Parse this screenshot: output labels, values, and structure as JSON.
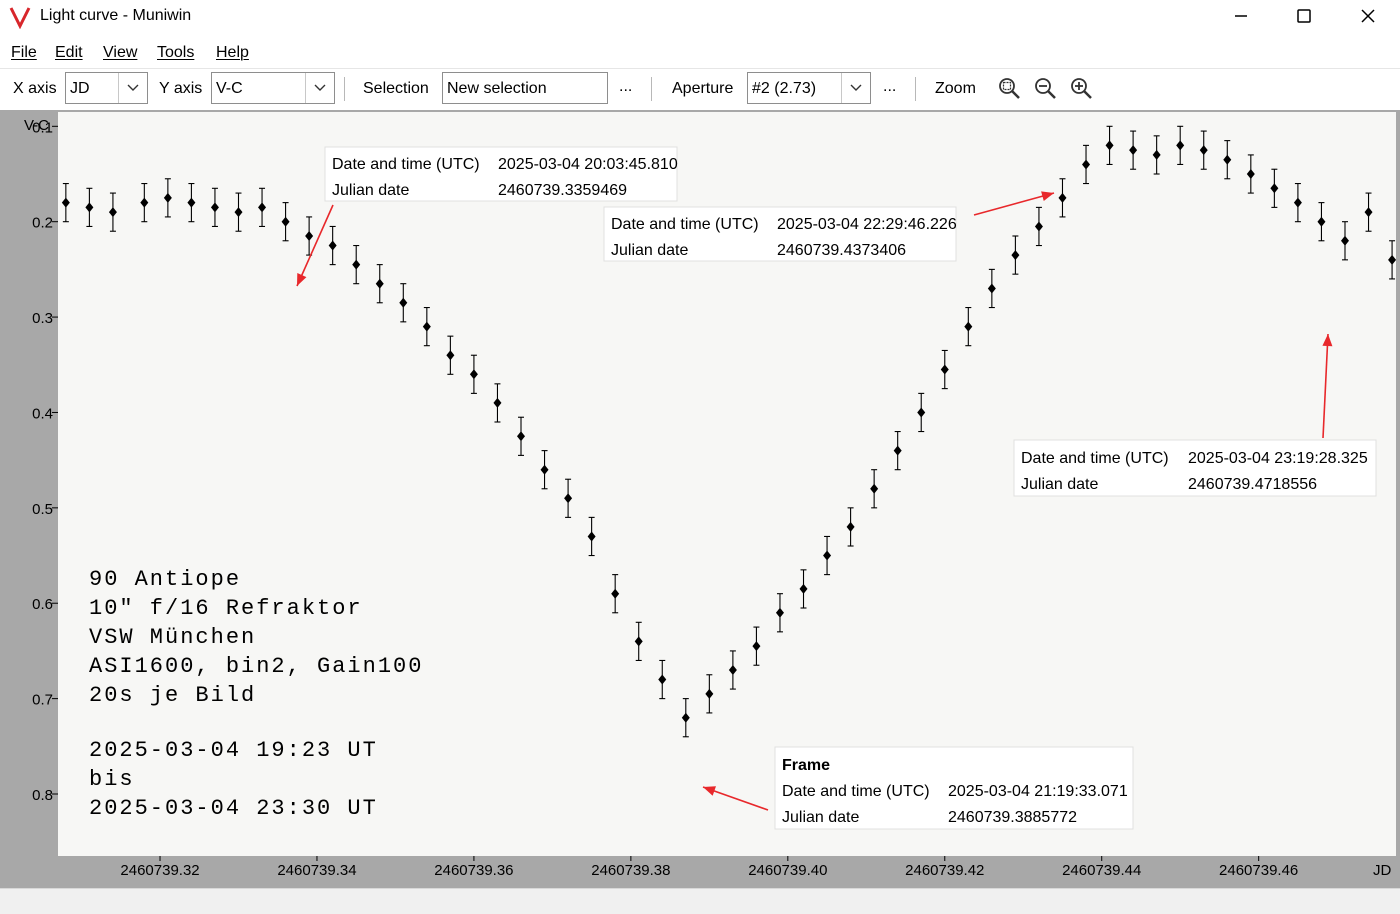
{
  "window": {
    "title": "Light curve - Muniwin"
  },
  "menu": [
    "File",
    "Edit",
    "View",
    "Tools",
    "Help"
  ],
  "toolbar": {
    "x_axis_label": "X axis",
    "x_axis_value": "JD",
    "y_axis_label": "Y axis",
    "y_axis_value": "V-C",
    "selection_label": "Selection",
    "selection_value": "New selection",
    "aperture_label": "Aperture",
    "aperture_value": "#2 (2.73)",
    "ellipsis": "...",
    "zoom_label": "Zoom"
  },
  "colors": {
    "plot_bg": "#f7f7f5",
    "frame_bg": "#a8a8a8",
    "marker": "#000000",
    "annotation_arrow": "#e8282b",
    "app_icon": "#d8262b"
  },
  "notes": {
    "lines_a": [
      "90 Antiope",
      "10\" f/16 Refraktor",
      "VSW München",
      "ASI1600, bin2, Gain100",
      "20s je Bild"
    ],
    "lines_b": [
      "2025-03-04 19:23 UT",
      "bis",
      "2025-03-04 23:30 UT"
    ]
  },
  "annotations": [
    {
      "header": "",
      "rows": [
        [
          "Date and time (UTC)",
          "2025-03-04 20:03:45.810"
        ],
        [
          "Julian date",
          "2460739.3359469"
        ]
      ]
    },
    {
      "header": "",
      "rows": [
        [
          "Date and time (UTC)",
          "2025-03-04 22:29:46.226"
        ],
        [
          "Julian date",
          "2460739.4373406"
        ]
      ]
    },
    {
      "header": "",
      "rows": [
        [
          "Date and time (UTC)",
          "2025-03-04 23:19:28.325"
        ],
        [
          "Julian date",
          "2460739.4718556"
        ]
      ]
    },
    {
      "header": "Frame",
      "rows": [
        [
          "Date and time (UTC)",
          "2025-03-04 21:19:33.071"
        ],
        [
          "Julian date",
          "2460739.3885772"
        ]
      ]
    }
  ],
  "chart_data": {
    "type": "scatter",
    "title": "",
    "xlabel": "JD",
    "ylabel": "V-C",
    "xlim": [
      2460739.307,
      2460739.4775
    ],
    "ylim": [
      0.085,
      0.865
    ],
    "y_inverted": true,
    "error_bars": true,
    "x_ticks": [
      2460739.32,
      2460739.34,
      2460739.36,
      2460739.38,
      2460739.4,
      2460739.42,
      2460739.44,
      2460739.46
    ],
    "x_tick_labels": [
      "2460739.32",
      "2460739.34",
      "2460739.36",
      "2460739.38",
      "2460739.40",
      "2460739.42",
      "2460739.44",
      "2460739.46"
    ],
    "y_ticks": [
      0.1,
      0.2,
      0.3,
      0.4,
      0.5,
      0.6,
      0.7,
      0.8
    ],
    "y_tick_labels": [
      "0.1",
      "0.2",
      "0.3",
      "0.4",
      "0.5",
      "0.6",
      "0.7",
      "0.8"
    ],
    "series": [
      {
        "x": [
          2460739.308,
          2460739.311,
          2460739.314,
          2460739.318,
          2460739.321,
          2460739.324,
          2460739.327,
          2460739.33,
          2460739.333,
          2460739.336,
          2460739.339,
          2460739.342,
          2460739.345,
          2460739.348,
          2460739.351,
          2460739.354,
          2460739.357,
          2460739.36,
          2460739.363,
          2460739.366,
          2460739.369,
          2460739.372,
          2460739.375,
          2460739.378,
          2460739.381,
          2460739.384,
          2460739.387,
          2460739.39,
          2460739.393,
          2460739.396,
          2460739.399,
          2460739.402,
          2460739.405,
          2460739.408,
          2460739.411,
          2460739.414,
          2460739.417,
          2460739.42,
          2460739.423,
          2460739.426,
          2460739.429,
          2460739.432,
          2460739.435,
          2460739.438,
          2460739.441,
          2460739.444,
          2460739.447,
          2460739.45,
          2460739.453,
          2460739.456,
          2460739.459,
          2460739.462,
          2460739.465,
          2460739.468,
          2460739.471,
          2460739.474,
          2460739.477
        ],
        "y": [
          0.18,
          0.185,
          0.19,
          0.18,
          0.175,
          0.18,
          0.185,
          0.19,
          0.185,
          0.2,
          0.215,
          0.225,
          0.245,
          0.265,
          0.285,
          0.31,
          0.34,
          0.36,
          0.39,
          0.425,
          0.46,
          0.49,
          0.53,
          0.59,
          0.64,
          0.68,
          0.72,
          0.695,
          0.67,
          0.645,
          0.61,
          0.585,
          0.55,
          0.52,
          0.48,
          0.44,
          0.4,
          0.355,
          0.31,
          0.27,
          0.235,
          0.205,
          0.175,
          0.14,
          0.12,
          0.125,
          0.13,
          0.12,
          0.125,
          0.135,
          0.15,
          0.165,
          0.18,
          0.2,
          0.22,
          0.19,
          0.24
        ],
        "error": 0.02
      }
    ]
  }
}
